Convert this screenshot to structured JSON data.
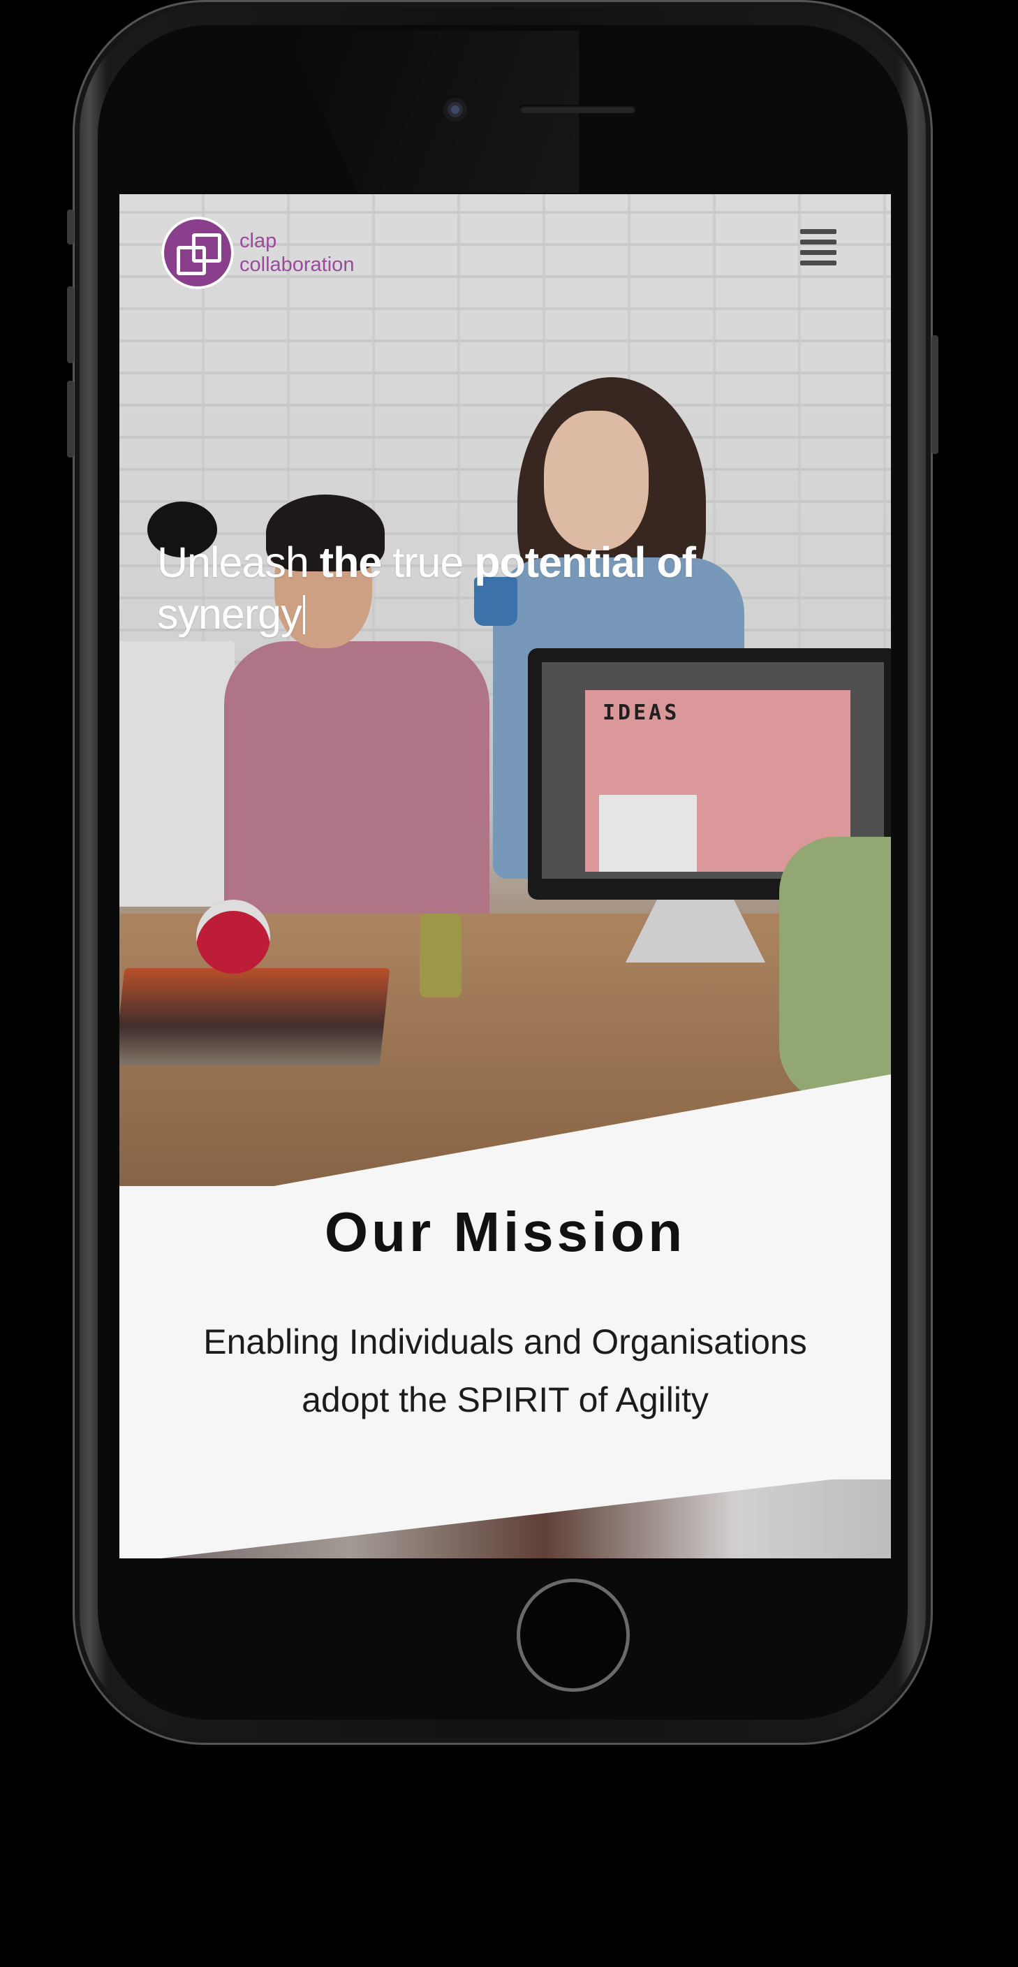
{
  "brand": {
    "logo_line1": "clap",
    "logo_line2": "collaboration",
    "accent_color": "#8a3f8c"
  },
  "nav": {
    "menu_icon": "hamburger-menu-icon"
  },
  "hero": {
    "headline_part1": "Unleash ",
    "headline_part2": "the",
    "headline_part3": " true ",
    "headline_part4": "potential of",
    "headline_part5": "synergy",
    "monitor_text": "IDEAS"
  },
  "mission": {
    "title": "Our Mission",
    "line1": "Enabling Individuals and Organisations",
    "line2": "adopt the SPIRIT of Agility"
  }
}
